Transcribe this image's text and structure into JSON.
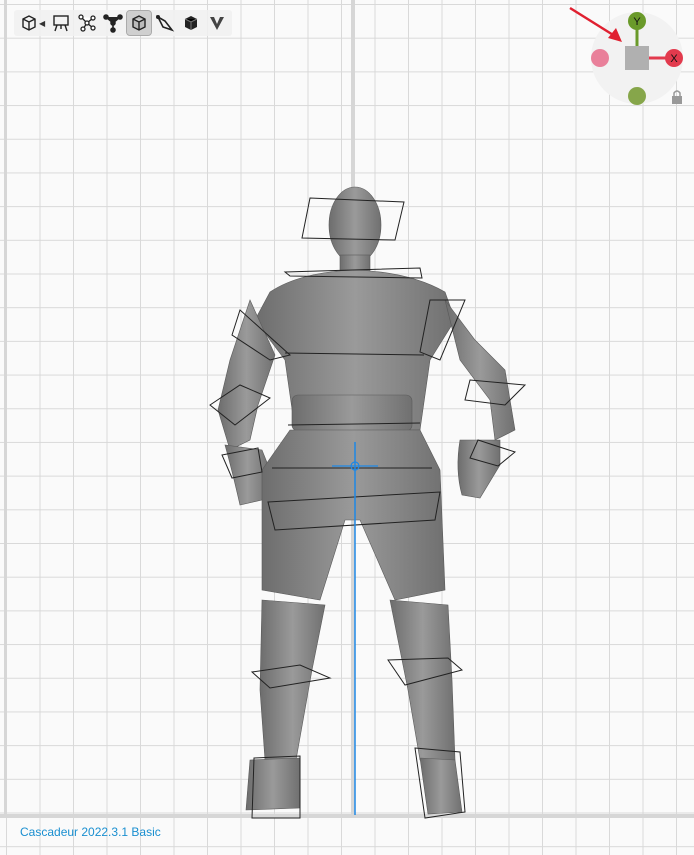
{
  "app": {
    "version_label": "Cascadeur 2022.3.1 Basic"
  },
  "toolbar": {
    "tools": [
      {
        "icon": "view-cube-icon",
        "active": false
      },
      {
        "icon": "easel-icon",
        "active": false
      },
      {
        "icon": "joints-icon",
        "active": false
      },
      {
        "icon": "point-controller-icon",
        "active": false
      },
      {
        "icon": "box-mesh-icon",
        "active": true
      },
      {
        "icon": "rigid-body-icon",
        "active": false
      },
      {
        "icon": "solid-cube-icon",
        "active": false
      },
      {
        "icon": "v-shape-icon",
        "active": false
      }
    ]
  },
  "gizmo": {
    "y_label": "Y",
    "x_label": "X",
    "colors": {
      "y": "#6a9a2a",
      "x": "#e23a4d",
      "neg": "#e9809a",
      "center": "#b0b0b0"
    }
  },
  "colors": {
    "grid": "#d9d9d9",
    "axis": "#1e88e5",
    "arrow": "#e02030",
    "mesh": "#8a8a8a"
  }
}
